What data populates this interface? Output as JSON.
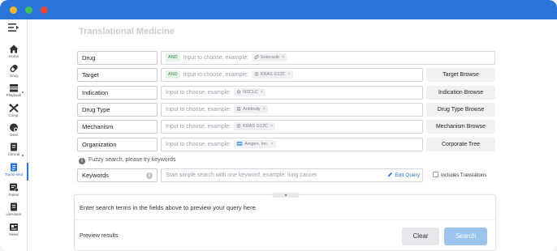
{
  "window": {
    "controls": [
      "minimize",
      "maximize",
      "close"
    ]
  },
  "sidebar": {
    "items": [
      {
        "label": "Home",
        "icon": "home-icon"
      },
      {
        "label": "Drug",
        "icon": "pill-icon"
      },
      {
        "label": "Playbook",
        "icon": "playbook-icon"
      },
      {
        "label": "Comp.",
        "icon": "compare-icon"
      },
      {
        "label": "Deal",
        "icon": "deal-icon"
      },
      {
        "label": "Clinical",
        "icon": "clinical-icon"
      },
      {
        "label": "Transl Med",
        "icon": "translational-icon"
      },
      {
        "label": "Patent",
        "icon": "patent-icon"
      },
      {
        "label": "Literature",
        "icon": "literature-icon"
      },
      {
        "label": "News",
        "icon": "news-icon"
      }
    ],
    "active": "Transl Med"
  },
  "page": {
    "title": "Translational Medicine"
  },
  "fields": [
    {
      "label": "Drug",
      "and": "AND",
      "placeholder": "Input to choose, example:",
      "chip": "Sotorasib",
      "browse": ""
    },
    {
      "label": "Target",
      "and": "AND",
      "placeholder": "Input to choose, example:",
      "chip": "KRAS G12C",
      "browse": "Target Browse"
    },
    {
      "label": "Indication",
      "and": "",
      "placeholder": "Input to choose, example:",
      "chip": "NSCLC",
      "browse": "Indication Browse"
    },
    {
      "label": "Drug Type",
      "and": "",
      "placeholder": "Input to choose, example:",
      "chip": "Antibody",
      "browse": "Drug Type Browse"
    },
    {
      "label": "Mechanism",
      "and": "",
      "placeholder": "Input to choose, example:",
      "chip": "KRAS G12C",
      "browse": "Mechanism Browse"
    },
    {
      "label": "Organization",
      "and": "",
      "placeholder": "Input to choose, example:",
      "chip": "Amgen, Inc.",
      "browse": "Corporate Tree"
    }
  ],
  "fuzzy_hint": "Fuzzy search, please try keywords",
  "keywords": {
    "label": "Keywords",
    "placeholder": "Start simple search with one keyword, example: lung cancer",
    "edit_query": "Edit Query",
    "includes_translations": "Includes Translations"
  },
  "preview": {
    "hint": "Enter search terms in the fields above to preview your query here",
    "results_label": "Preview results",
    "clear": "Clear",
    "search": "Search"
  },
  "colors": {
    "brand": "#2b74d8",
    "search_disabled": "#9cc4ec",
    "and_tag_bg": "#e3f3e6"
  }
}
